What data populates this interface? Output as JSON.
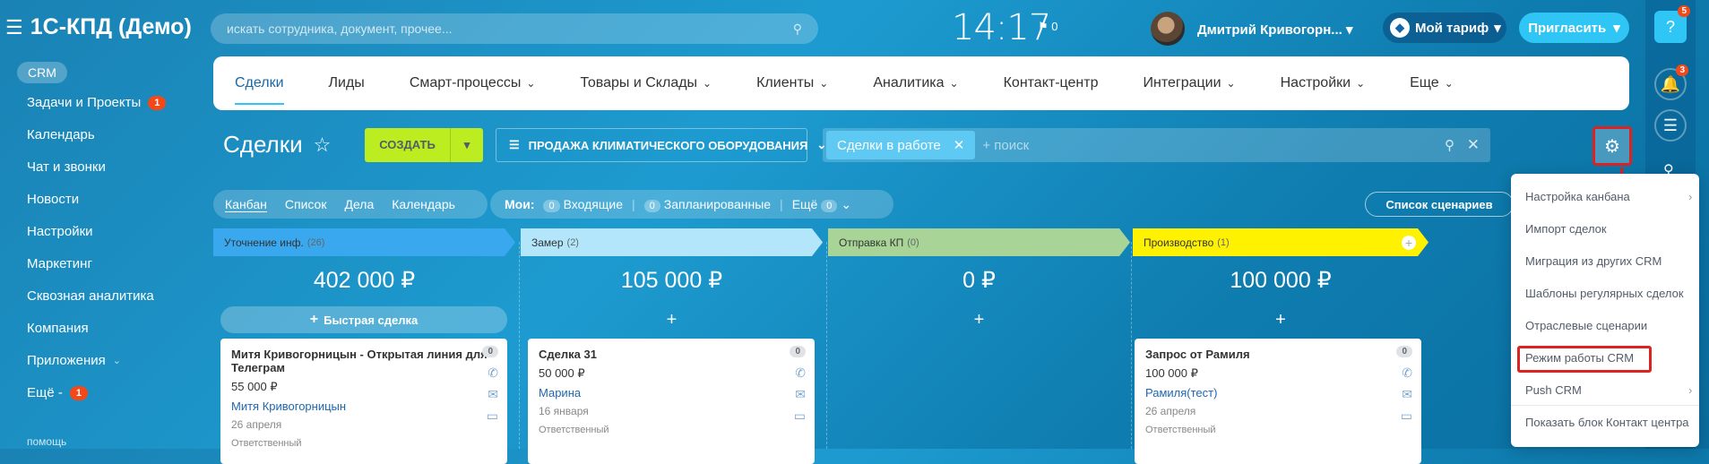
{
  "app": {
    "title": "1С-КПД (Демо)",
    "section": "CRM"
  },
  "search": {
    "placeholder": "искать сотрудника, документ, прочее..."
  },
  "header": {
    "time": "14:17",
    "flag_count": "0",
    "user": "Дмитрий Кривогорн...",
    "tariff": "Мой тариф",
    "invite": "Пригласить"
  },
  "sidebar": {
    "items": [
      {
        "label": "Задачи и Проекты",
        "badge": "1"
      },
      {
        "label": "Календарь"
      },
      {
        "label": "Чат и звонки"
      },
      {
        "label": "Новости"
      },
      {
        "label": "Настройки"
      },
      {
        "label": "Маркетинг"
      },
      {
        "label": "Сквозная аналитика"
      },
      {
        "label": "Компания"
      },
      {
        "label": "Приложения"
      },
      {
        "label": "Ещё -",
        "badge": "1"
      }
    ],
    "bottom": "помощь"
  },
  "rightbar": {
    "help_badge": "5",
    "bell_badge": "3"
  },
  "topnav": {
    "items": [
      "Сделки",
      "Лиды",
      "Смарт-процессы",
      "Товары и Склады",
      "Клиенты",
      "Аналитика",
      "Контакт-центр",
      "Интеграции",
      "Настройки",
      "Еще"
    ]
  },
  "toolbar": {
    "title": "Сделки",
    "create": "СОЗДАТЬ",
    "funnel": "ПРОДАЖА КЛИМАТИЧЕСКОГО ОБОРУДОВАНИЯ",
    "filter_chip": "Сделки в работе",
    "filter_placeholder": "+ поиск"
  },
  "views": {
    "items": [
      "Канбан",
      "Список",
      "Дела",
      "Календарь"
    ]
  },
  "mine": {
    "label": "Мои:",
    "incoming": "Входящие",
    "incoming_count": "0",
    "planned": "Запланированные",
    "planned_count": "0",
    "more": "Ещё",
    "more_count": "0"
  },
  "scenarios": "Список сценариев",
  "columns": [
    {
      "name": "Уточнение инф.",
      "count": "(26)",
      "sum": "402 000 ₽",
      "color": "#39a8ef"
    },
    {
      "name": "Замер",
      "count": "(2)",
      "sum": "105 000 ₽",
      "color": "#b3e6fb"
    },
    {
      "name": "Отправка КП",
      "count": "(0)",
      "sum": "0 ₽",
      "color": "#a9d497"
    },
    {
      "name": "Производство",
      "count": "(1)",
      "sum": "100 000 ₽",
      "color": "#fff200"
    }
  ],
  "quick_deal": "Быстрая сделка",
  "cards": [
    {
      "title": "Митя Кривогорницын - Открытая линия для Телеграм",
      "amount": "55 000 ₽",
      "contact": "Митя Кривогорницын",
      "date": "26 апреля",
      "badge": "0",
      "resp": "Ответственный"
    },
    {
      "title": "Сделка 31",
      "amount": "50 000 ₽",
      "contact": "Марина",
      "date": "16 января",
      "badge": "0",
      "resp": "Ответственный"
    },
    {
      "title": "Запрос от Рамиля",
      "amount": "100 000 ₽",
      "contact": "Рамиля(тест)",
      "date": "26 апреля",
      "badge": "0",
      "resp": "Ответственный"
    }
  ],
  "menu": {
    "items": [
      "Настройка канбана",
      "Импорт сделок",
      "Миграция из других CRM",
      "Шаблоны регулярных сделок",
      "Отраслевые сценарии",
      "Режим работы CRM",
      "Push CRM",
      "Показать блок Контакт центра"
    ]
  }
}
